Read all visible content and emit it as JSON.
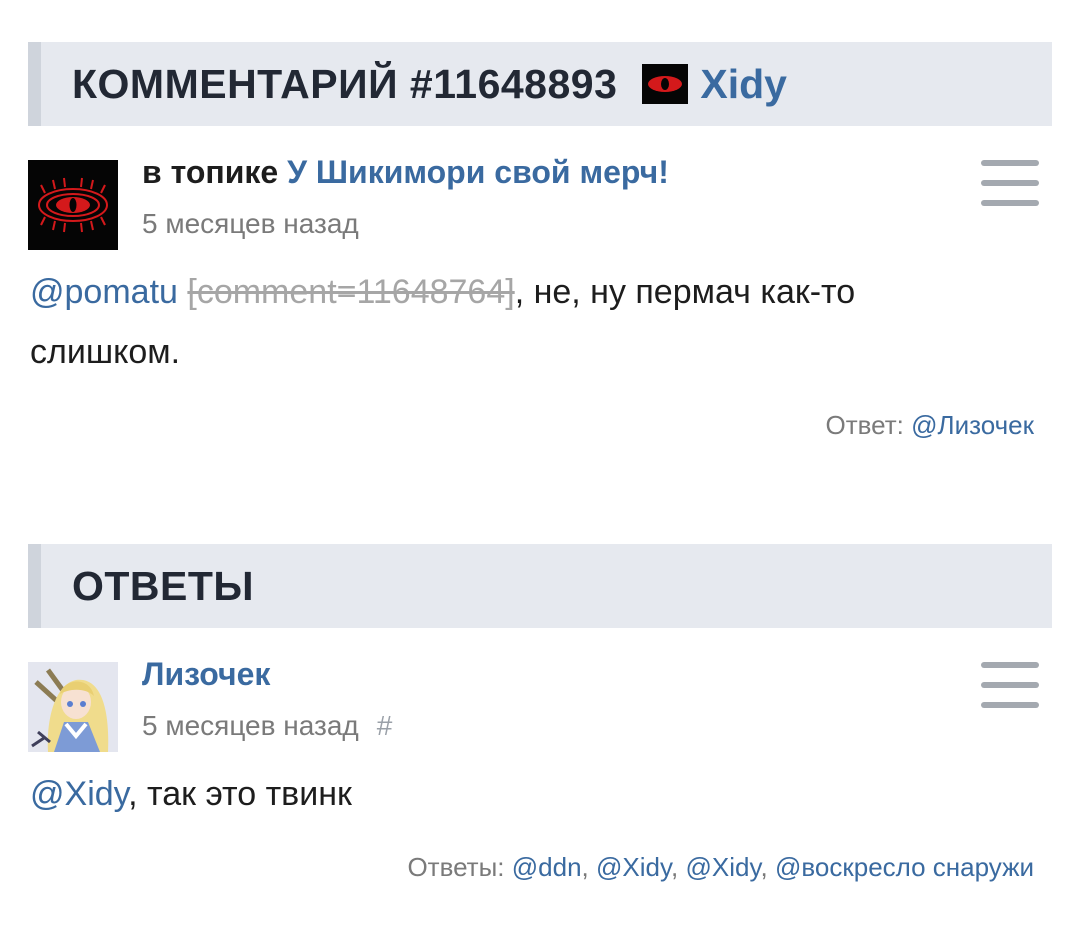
{
  "comment_header": {
    "title": "КОММЕНТАРИЙ #11648893",
    "user": "Xidy"
  },
  "comment": {
    "topic_prefix": "в топике",
    "topic_title": "У Шикимори свой мерч!",
    "time": "5 месяцев назад",
    "mention": "@pomatu",
    "quote_tag": "[comment=11648764]",
    "text_after": ", не, ну пермач как-то",
    "text_line2": "слишком.",
    "reply_label": "Ответ:",
    "reply_user": "@Лизочек"
  },
  "answers_header": {
    "title": "ОТВЕТЫ"
  },
  "answer": {
    "author": "Лизочек",
    "time": "5 месяцев назад",
    "hash": "#",
    "mention": "@Xidy",
    "text": ", так это твинк",
    "replies_label": "Ответы:",
    "replies": [
      "@ddn",
      "@Xidy",
      "@Xidy",
      "@воскресло снаружи"
    ]
  },
  "colors": {
    "link": "#3a6aa0",
    "header_bg": "#e6e9ef",
    "eye_red": "#d4191b"
  }
}
